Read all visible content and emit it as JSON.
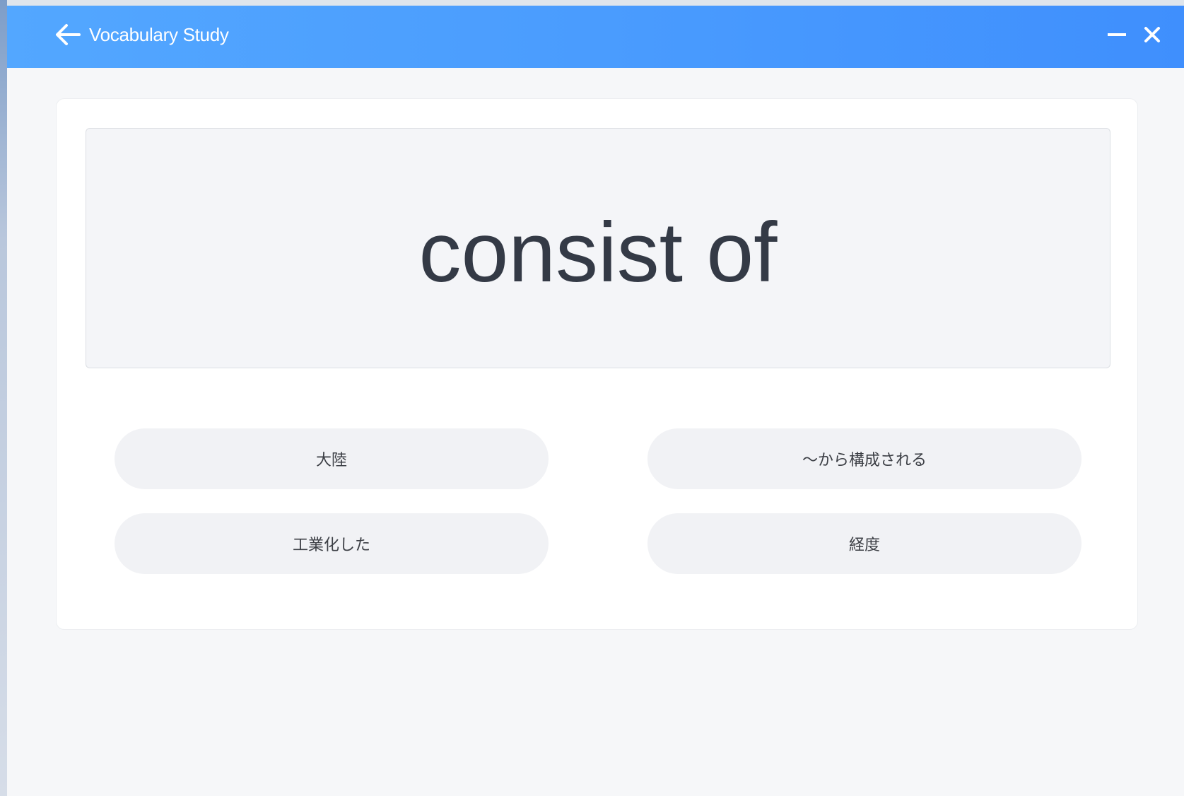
{
  "window": {
    "title": "Vocabulary Study",
    "icons": {
      "back": "arrow-left-icon",
      "minimize": "minus-icon",
      "close": "close-icon"
    },
    "colors": {
      "titlebar_start": "#53a7ff",
      "titlebar_end": "#3f8ffd",
      "text_primary": "#343a46"
    }
  },
  "quiz": {
    "word": "consist of",
    "options": [
      {
        "label": "大陸"
      },
      {
        "label": "～から構成される"
      },
      {
        "label": "工業化した"
      },
      {
        "label": "経度"
      }
    ]
  }
}
